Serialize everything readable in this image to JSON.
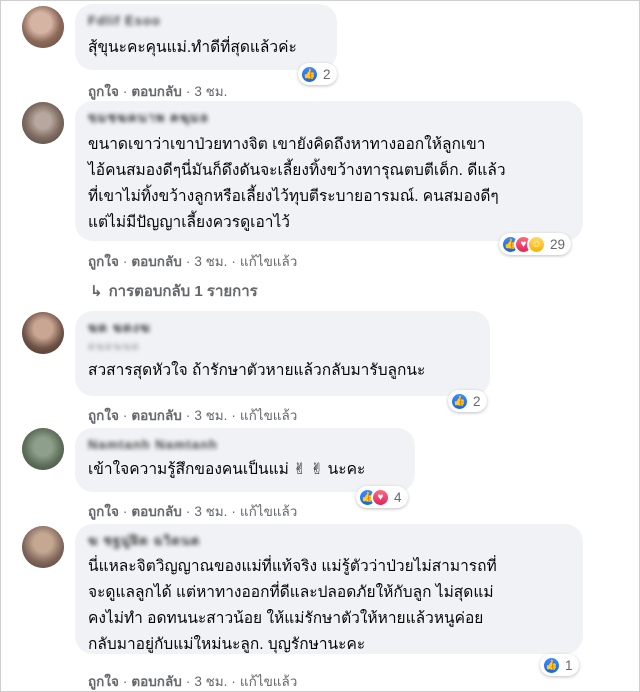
{
  "comments": [
    {
      "name": "Fdlif Esoo",
      "subname": "",
      "lines": [
        "สุ้ขุนะคะคุนแม่.ทำดีที่สุดแล้วค่ะ"
      ],
      "reaction_count": "2",
      "actions": {
        "like": "ถูกใจ",
        "reply": "ตอบกลับ",
        "time": "3 ชม.",
        "edited": ""
      }
    },
    {
      "name": "ขมชฆคนาพ ฅฆุมล",
      "subname": "",
      "lines": [
        "ขนาดเขาว่าเขาป่วยทางจิต เขายังคิดถึงหาทางออกให้ลูกเขา",
        "ไอ้คนสมองดีๆนี่มันก็ดึงดันจะเลี้ยงทิ้งขว้างทารุณตบตีเด็ก. ดีแล้ว",
        "ที่เขาไม่ทิ้งขว้างลูกหรือเลี้ยงไว้ทุบตีระบายอารมณ์. คนสมองดีๆ",
        "แต่ไม่มีปัญญาเลี้ยงควรดูเอาไว้"
      ],
      "reaction_count": "29",
      "actions": {
        "like": "ถูกใจ",
        "reply": "ตอบกลับ",
        "time": "3 ชม.",
        "edited": "แก้ไขแล้ว"
      },
      "replies_label": "การตอบกลับ 1 รายการ"
    },
    {
      "name": "ฆด ฆดงฆ",
      "subname": "ดฆดฆฆด",
      "lines": [
        "สวสารสุดหัวใจ ถ้ารักษาตัวหายแล้วกลับมารับลูกนะ"
      ],
      "reaction_count": "2",
      "actions": {
        "like": "ถูกใจ",
        "reply": "ตอบกลับ",
        "time": "3 ชม.",
        "edited": "แก้ไขแล้ว"
      }
    },
    {
      "name": "Namtanh Namtanh",
      "subname": "",
      "lines": [
        "เข้าใจความรู้สึกของคนเป็นแม่ ✌ ✌ นะคะ"
      ],
      "reaction_count": "4",
      "actions": {
        "like": "ถูกใจ",
        "reply": "ตอบกลับ",
        "time": "3 ชม.",
        "edited": "แก้ไขแล้ว"
      }
    },
    {
      "name": "ฆ ชฐมู่ฝิด ฉวิดนด",
      "subname": "",
      "lines": [
        "นี่แหละจิตวิญญาณของแม่ที่แท้จริง แม่รู้ตัวว่าป่วยไม่สามารถที่",
        "จะดูแลลูกได้ แต่หาทางออกที่ดีและปลอดภัยให้กับลูก ไม่สุดแม่",
        "คงไม่ทำ อดทนนะสาวน้อย ให้แม่รักษาตัวให้หายแล้วหนูค่อย",
        "กลับมาอยู่กับแม่ใหม่นะลูก. บุญรักษานะคะ"
      ],
      "reaction_count": "1",
      "actions": {
        "like": "ถูกใจ",
        "reply": "ตอบกลับ",
        "time": "3 ชม.",
        "edited": "แก้ไขแล้ว"
      }
    }
  ],
  "icons": {
    "like": "like-reaction-icon",
    "love": "love-reaction-icon",
    "care": "care-reaction-icon",
    "reply_arrow": "reply-arrow-icon"
  },
  "colors": {
    "bubble": "#f0f2f5",
    "meta_text": "#65676b",
    "like_blue": "#1877f2"
  }
}
